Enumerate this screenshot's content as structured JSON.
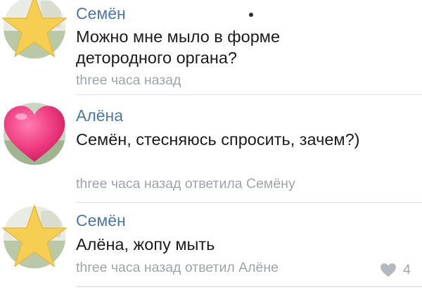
{
  "comments": [
    {
      "author": "Семён",
      "text": "Можно мне мыло в форме детородного органа?",
      "meta": "three часа назад",
      "avatar_icon": "star-icon"
    },
    {
      "author": "Алёна",
      "text": "Семён, стесняюсь спросить, зачем?)",
      "meta": "three часа назад ответила Семёну",
      "avatar_icon": "heart-icon"
    },
    {
      "author": "Семён",
      "text": "Алёна, жопу мыть",
      "meta": "three часа назад ответил Алёне",
      "avatar_icon": "star-icon"
    }
  ],
  "likes": {
    "count": "4",
    "icon": "heart-outline-icon"
  },
  "colors": {
    "author": "#4a76a8",
    "meta": "#9ea4ab",
    "text": "#1b1b1b",
    "star": "#f6cf52",
    "heart": "#ee3a7e"
  }
}
